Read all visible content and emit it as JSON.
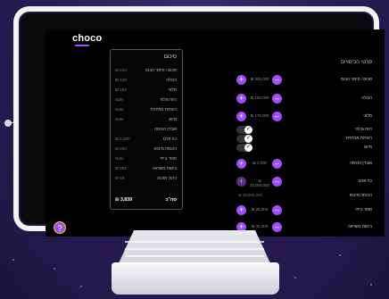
{
  "app": {
    "logo": "choco"
  },
  "summary": {
    "title": "סיכום",
    "rows": [
      {
        "label": "סכום / סימני הבנה",
        "value": "₪ 234"
      },
      {
        "label": "הכולה",
        "value": "₪ 128"
      },
      {
        "label": "מלאי",
        "value": "₪ 193"
      },
      {
        "label": "רווח גולמי",
        "value": "NaN"
      },
      {
        "label": "רווחיות אמיתית",
        "value": "NaN"
      },
      {
        "label": "מיזוג",
        "value": "NaN"
      },
      {
        "label": "אובדן הכנסה",
        "value": ""
      },
      {
        "label": "כח אדם",
        "value": "₪ 2,500"
      },
      {
        "label": "הכנסה מיבוא",
        "value": "₪ 280"
      },
      {
        "label": "סופר ביתי",
        "value": "NaN"
      },
      {
        "label": "ביטוח בשגיאה",
        "value": "₪ 351"
      },
      {
        "label": "ניהול תוכנה",
        "value": "₪ 69"
      }
    ],
    "total": {
      "label": "סה\"כ",
      "value": "₪ 3,839"
    }
  },
  "panel": {
    "title": "פרטי הכיסויים",
    "rows": [
      {
        "label": "סכום / סימני הבנה",
        "kind": "stepper",
        "value": "₪ 300,000"
      },
      {
        "label": "הכולה",
        "kind": "stepper",
        "value": "₪ 150,000"
      },
      {
        "label": "מלאי",
        "kind": "stepper",
        "value": "₪ 175,000"
      },
      {
        "label": "רווח גולמי",
        "kind": "toggle"
      },
      {
        "label": "רווחיות אמיתית",
        "kind": "toggle"
      },
      {
        "label": "מיזוג",
        "kind": "toggle"
      },
      {
        "label": "אובדן הכנסה",
        "kind": "stepper",
        "value": "₪ 2,000"
      },
      {
        "label": "כח אדם",
        "kind": "stepper",
        "value": "₪ 20,000,000"
      },
      {
        "label": "הכנסה מיבוא",
        "kind": "plain",
        "value": "₪ 20,000,000"
      },
      {
        "label": "סופר ביתי",
        "kind": "stepper",
        "value": "₪ 25,000"
      },
      {
        "label": "ביטוח בשגיאה",
        "kind": "stepper",
        "value": "₪ 35,000"
      }
    ]
  },
  "help": {
    "label": "?"
  },
  "icons": {
    "plus": "+",
    "minus": "–",
    "check": "✓"
  }
}
